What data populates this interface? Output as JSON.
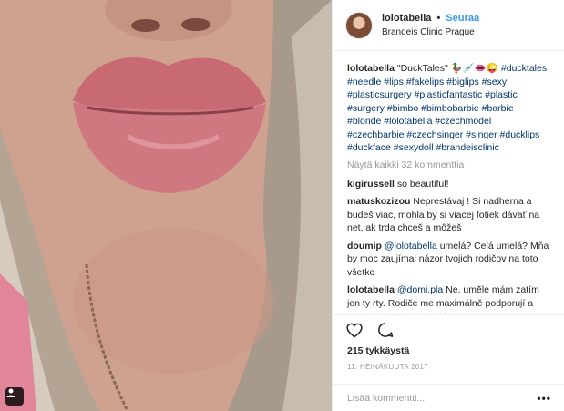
{
  "post": {
    "photo_description_icon": "photo-of-lips",
    "tag_icon": "person-tag-icon"
  },
  "header": {
    "username": "lolotabella",
    "separator": "•",
    "follow_label": "Seuraa",
    "location": "Brandeis Clinic Prague"
  },
  "caption": {
    "username": "lolotabella",
    "text": "\"DuckTales\" 🦆💉👄😜",
    "hashtags": "#ducktales #needle #lips #fakelips #biglips #sexy #plasticsurgery #plasticfantastic #plastic #surgery #bimbo #bimbobarbie #barbie #blonde #lolotabella #czechmodel #czechbarbie #czechsinger #singer #ducklips #duckface #sexydoll #brandeisclinic"
  },
  "view_all": "Näytä kaikki 32 kommenttia",
  "comments": [
    {
      "username": "kigirussell",
      "mention": "",
      "text": "so beautiful!"
    },
    {
      "username": "matuskozizou",
      "mention": "",
      "text": "Neprestávaj ! Si nadherna a budeš viac, mohla by si viacej fotiek dávať na net, ak trda chceš a môžeš"
    },
    {
      "username": "doumip",
      "mention": "@lolotabella",
      "text": "umelá? Celá umelá? Mňa by moc zaujímal názor tvojich rodičov na toto všetko"
    },
    {
      "username": "lolotabella",
      "mention": "@domi.pla",
      "text": "Ne, umĕle mám zatím jen ty rty. Rodiče me maximálně podporují a spokojí to snad v každém"
    }
  ],
  "actions": {
    "like_icon": "heart-icon",
    "comment_icon": "comment-bubble-icon"
  },
  "likes": "215 tykkäystä",
  "date": "11. HEINÄKUUTA 2017",
  "add_comment": {
    "placeholder": "Lisää kommentti...",
    "more_label": "•••"
  },
  "colors": {
    "link_blue": "#3897f0",
    "hashtag_navy": "#003569",
    "muted": "#999999",
    "divider": "#efefef"
  }
}
